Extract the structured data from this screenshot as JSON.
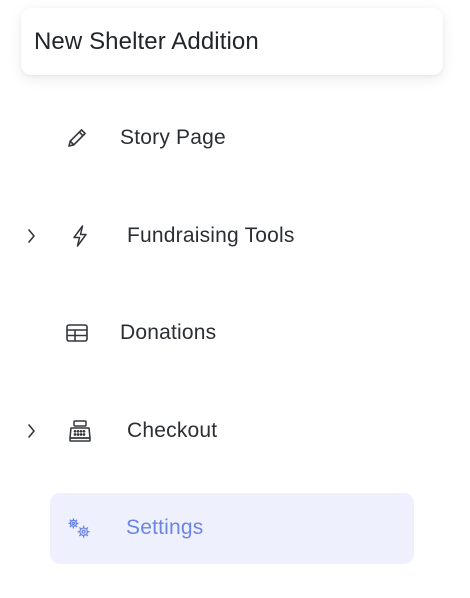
{
  "campaign": {
    "title": "New Shelter Addition"
  },
  "nav": {
    "items": [
      {
        "label": "Story Page",
        "icon": "pencil-icon",
        "expandable": false,
        "active": false
      },
      {
        "label": "Fundraising Tools",
        "icon": "lightning-icon",
        "expandable": true,
        "active": false
      },
      {
        "label": "Donations",
        "icon": "table-icon",
        "expandable": false,
        "active": false
      },
      {
        "label": "Checkout",
        "icon": "cash-register-icon",
        "expandable": true,
        "active": false
      },
      {
        "label": "Settings",
        "icon": "gears-icon",
        "expandable": false,
        "active": true
      }
    ]
  },
  "colors": {
    "active_bg": "#eef1fd",
    "active_text": "#6b85e4",
    "text": "#2b2f33"
  }
}
